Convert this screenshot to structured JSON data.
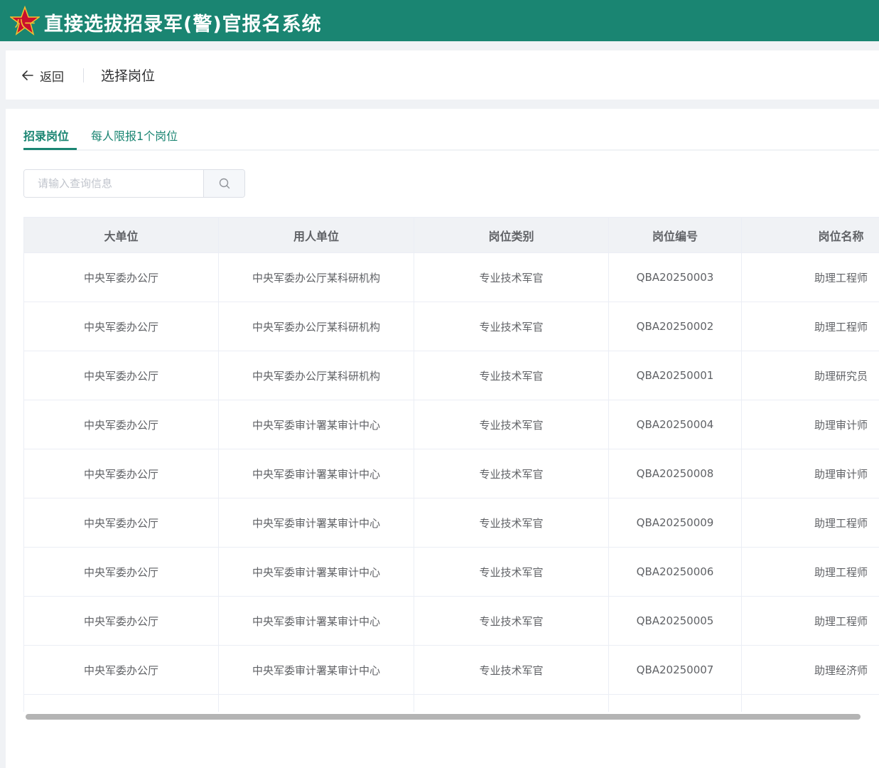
{
  "app": {
    "title": "直接选拔招录军(警)官报名系统"
  },
  "topbar": {
    "back_label": "返回",
    "page_title": "选择岗位"
  },
  "tabs": {
    "active_label": "招录岗位",
    "note": "每人限报1个岗位"
  },
  "search": {
    "placeholder": "请输入查询信息"
  },
  "table": {
    "headers": [
      "大单位",
      "用人单位",
      "岗位类别",
      "岗位编号",
      "岗位名称"
    ],
    "rows": [
      [
        "中央军委办公厅",
        "中央军委办公厅某科研机构",
        "专业技术军官",
        "QBA20250003",
        "助理工程师"
      ],
      [
        "中央军委办公厅",
        "中央军委办公厅某科研机构",
        "专业技术军官",
        "QBA20250002",
        "助理工程师"
      ],
      [
        "中央军委办公厅",
        "中央军委办公厅某科研机构",
        "专业技术军官",
        "QBA20250001",
        "助理研究员"
      ],
      [
        "中央军委办公厅",
        "中央军委审计署某审计中心",
        "专业技术军官",
        "QBA20250004",
        "助理审计师"
      ],
      [
        "中央军委办公厅",
        "中央军委审计署某审计中心",
        "专业技术军官",
        "QBA20250008",
        "助理审计师"
      ],
      [
        "中央军委办公厅",
        "中央军委审计署某审计中心",
        "专业技术军官",
        "QBA20250009",
        "助理工程师"
      ],
      [
        "中央军委办公厅",
        "中央军委审计署某审计中心",
        "专业技术军官",
        "QBA20250006",
        "助理工程师"
      ],
      [
        "中央军委办公厅",
        "中央军委审计署某审计中心",
        "专业技术军官",
        "QBA20250005",
        "助理工程师"
      ],
      [
        "中央军委办公厅",
        "中央军委审计署某审计中心",
        "专业技术军官",
        "QBA20250007",
        "助理经济师"
      ]
    ]
  },
  "colors": {
    "brand": "#1a8572",
    "background": "#f0f2f5",
    "logo_red": "#c8102e",
    "logo_gold": "#f2c230"
  },
  "icons": {
    "back": "arrow-left-icon",
    "search": "search-icon",
    "logo": "emblem-icon"
  }
}
